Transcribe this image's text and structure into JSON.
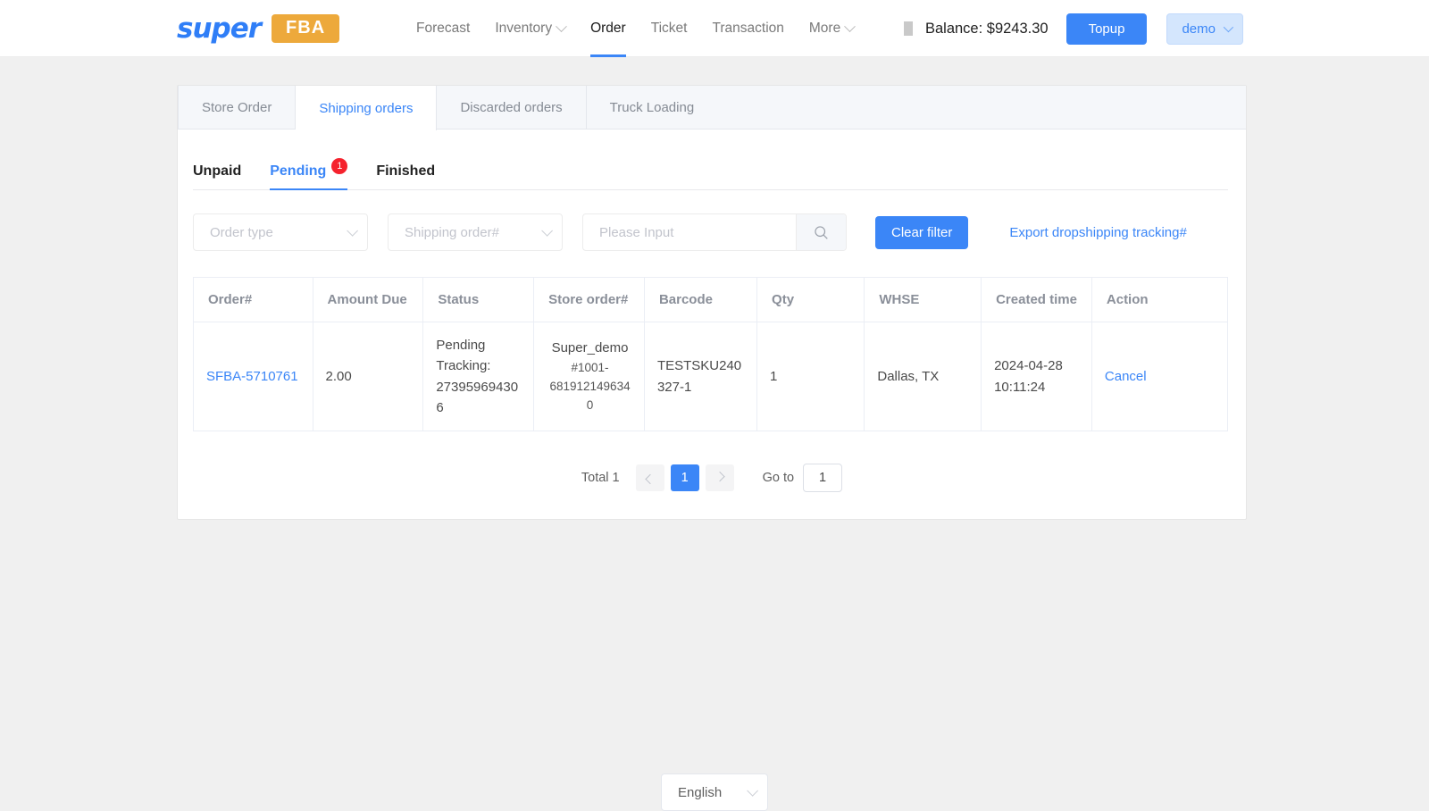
{
  "header": {
    "logo": {
      "primary": "super",
      "badge": "FBA"
    },
    "nav": [
      {
        "label": "Forecast",
        "has_caret": false,
        "active": false
      },
      {
        "label": "Inventory",
        "has_caret": true,
        "active": false
      },
      {
        "label": "Order",
        "has_caret": false,
        "active": true
      },
      {
        "label": "Ticket",
        "has_caret": false,
        "active": false
      },
      {
        "label": "Transaction",
        "has_caret": false,
        "active": false
      },
      {
        "label": "More",
        "has_caret": true,
        "active": false
      }
    ],
    "balance_label": "Balance: $9243.30",
    "topup_label": "Topup",
    "account_label": "demo"
  },
  "tabs": [
    {
      "label": "Store Order",
      "active": false
    },
    {
      "label": "Shipping orders",
      "active": true
    },
    {
      "label": "Discarded orders",
      "active": false
    },
    {
      "label": "Truck Loading",
      "active": false
    }
  ],
  "subtabs": [
    {
      "label": "Unpaid",
      "badge": "",
      "active": false
    },
    {
      "label": "Pending",
      "badge": "1",
      "active": true
    },
    {
      "label": "Finished",
      "badge": "",
      "active": false
    }
  ],
  "filters": {
    "order_type": "Order type",
    "shipping_order": "Shipping order#",
    "search_placeholder": "Please Input",
    "search_value": "",
    "search_icon": "search-icon",
    "clear_filter_label": "Clear filter",
    "export_link_label": "Export dropshipping tracking#"
  },
  "table": {
    "columns": [
      "Order#",
      "Amount Due",
      "Status",
      "Store order#",
      "Barcode",
      "Qty",
      "WHSE",
      "Created time",
      "Action"
    ],
    "rows": [
      {
        "order_no": "SFBA-5710761",
        "amount_due": "2.00",
        "status": "Pending",
        "tracking": "Tracking: 273959694306",
        "store_order_name": "Super_demo",
        "store_order_no": "#1001-6819121496340",
        "barcode": "TESTSKU240327-1",
        "qty": "1",
        "whse": "Dallas, TX",
        "created_time": "2024-04-28 10:11:24",
        "action": "Cancel"
      }
    ]
  },
  "pagination": {
    "total_label": "Total 1",
    "current_page": "1",
    "goto_label": "Go to",
    "goto_value": "1"
  },
  "footer": {
    "language": "English"
  },
  "colors": {
    "accent": "#3b86f7",
    "brand_orange": "#eda93b",
    "badge_red": "#f5222d",
    "page_bg": "#f0f0f0"
  }
}
